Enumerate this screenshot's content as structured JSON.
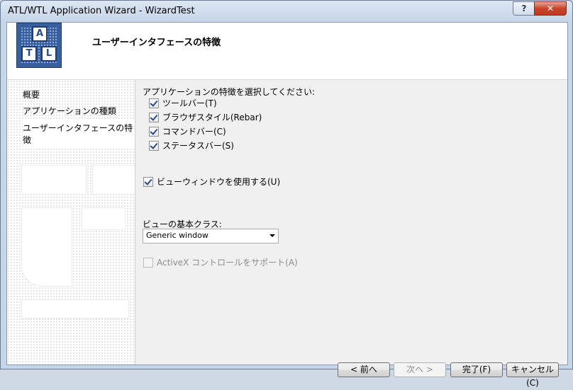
{
  "window": {
    "title": "ATL/WTL Application Wizard - WizardTest",
    "help_label": "?",
    "close_label": "✕"
  },
  "header": {
    "title": "ユーザーインタフェースの特徴",
    "logo_letters": [
      "A",
      "T",
      "L"
    ]
  },
  "sidebar": {
    "items": [
      {
        "label": "概要",
        "selected": false
      },
      {
        "label": "アプリケーションの種類",
        "selected": false
      },
      {
        "label": "ユーザーインタフェースの特徴",
        "selected": true
      }
    ]
  },
  "main": {
    "group_label": "アプリケーションの特徴を選択してください:",
    "features": [
      {
        "label": "ツールバー(T)",
        "checked": true
      },
      {
        "label": "ブラウザスタイル(Rebar)",
        "checked": true
      },
      {
        "label": "コマンドバー(C)",
        "checked": true
      },
      {
        "label": "ステータスバー(S)",
        "checked": true
      }
    ],
    "use_view": {
      "label": "ビューウィンドウを使用する(U)",
      "checked": true
    },
    "view_class_label": "ビューの基本クラス:",
    "view_class_value": "Generic window",
    "activex": {
      "label": "ActiveX コントロールをサポート(A)",
      "checked": false,
      "enabled": false
    }
  },
  "buttons": {
    "back": "< 前へ",
    "next": "次へ >",
    "finish": "完了(F)",
    "cancel": "キャンセル(C)"
  }
}
